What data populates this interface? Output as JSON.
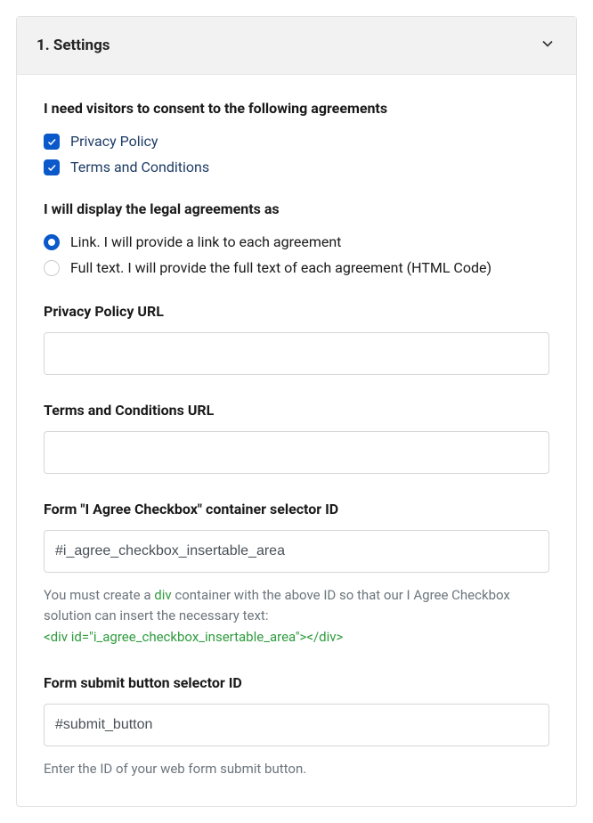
{
  "header": {
    "title": "1. Settings"
  },
  "consent": {
    "heading": "I need visitors to consent to the following agreements",
    "items": [
      {
        "label": "Privacy Policy",
        "checked": true
      },
      {
        "label": "Terms and Conditions",
        "checked": true
      }
    ]
  },
  "display": {
    "heading": "I will display the legal agreements as",
    "options": [
      {
        "label": "Link. I will provide a link to each agreement",
        "selected": true
      },
      {
        "label": "Full text. I will provide the full text of each agreement (HTML Code)",
        "selected": false
      }
    ]
  },
  "privacy_url": {
    "label": "Privacy Policy URL",
    "value": ""
  },
  "terms_url": {
    "label": "Terms and Conditions URL",
    "value": ""
  },
  "container_id": {
    "label": "Form \"I Agree Checkbox\" container selector ID",
    "value": "#i_agree_checkbox_insertable_area",
    "help_pre": "You must create a ",
    "help_div": "div",
    "help_post": " container with the above ID so that our I Agree Checkbox solution can insert the necessary text:",
    "help_code": "<div id=\"i_agree_checkbox_insertable_area\"></div>"
  },
  "submit_id": {
    "label": "Form submit button selector ID",
    "value": "#submit_button",
    "help": "Enter the ID of your web form submit button."
  }
}
